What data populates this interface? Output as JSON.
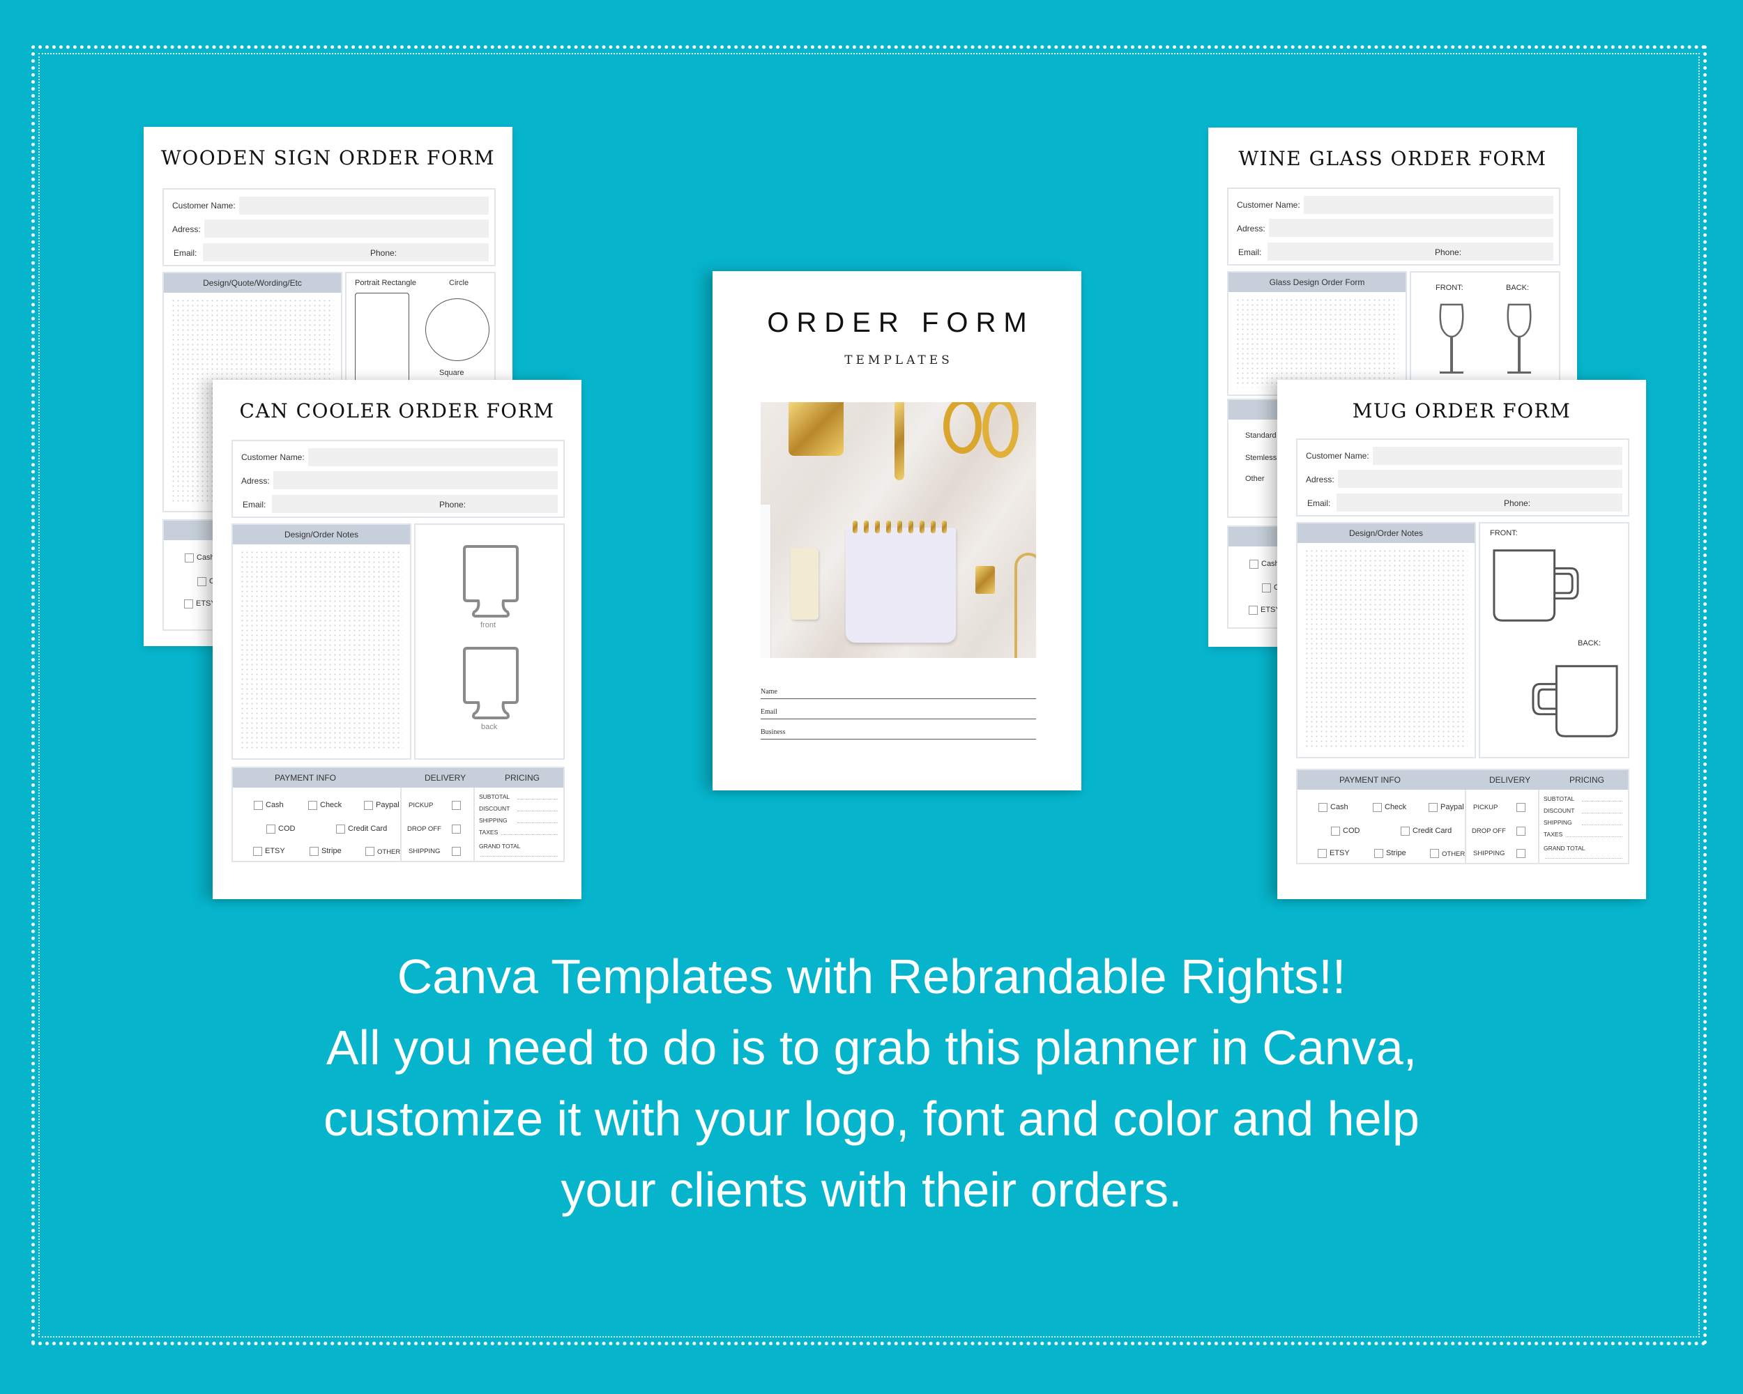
{
  "background_color": "#06b5cc",
  "info_labels": {
    "customer": "Customer Name:",
    "address": "Adress:",
    "email": "Email:",
    "phone": "Phone:"
  },
  "payment": {
    "headers": {
      "payment": "PAYMENT INFO",
      "delivery": "DELIVERY",
      "pricing": "PRICING"
    },
    "methods": [
      "Cash",
      "Check",
      "Paypal",
      "COD",
      "Credit Card",
      "ETSY",
      "Stripe",
      "OTHER"
    ],
    "delivery": [
      "PICKUP",
      "DROP OFF",
      "SHIPPING"
    ],
    "pricing": [
      "SUBTOTAL",
      "DISCOUNT",
      "SHIPPING",
      "TAXES",
      "GRAND  TOTAL"
    ]
  },
  "forms": {
    "wooden": {
      "title": "WOODEN SIGN ORDER FORM",
      "design_header": "Design/Quote/Wording/Etc",
      "shapes": [
        "Portrait Rectangle",
        "Circle",
        "Square"
      ]
    },
    "wine": {
      "title": "WINE GLASS ORDER FORM",
      "design_header": "Glass Design Order Form",
      "views": [
        "FRONT:",
        "BACK:"
      ],
      "styles": [
        "Standard",
        "Stemless",
        "Other"
      ]
    },
    "can": {
      "title": "CAN COOLER ORDER FORM",
      "design_header": "Design/Order Notes",
      "views": [
        "front",
        "back"
      ]
    },
    "mug": {
      "title": "MUG ORDER FORM",
      "design_header": "Design/Order Notes",
      "views": [
        "FRONT:",
        "BACK:"
      ]
    }
  },
  "cover": {
    "title": "ORDER FORM",
    "subtitle": "TEMPLATES",
    "fields": [
      "Name",
      "Email",
      "Business"
    ]
  },
  "caption": {
    "lines": [
      "Canva Templates with Rebrandable Rights!!",
      "All you need to do is to grab this planner in Canva,",
      "customize it with your logo, font and color and help",
      "your clients with their orders."
    ]
  }
}
